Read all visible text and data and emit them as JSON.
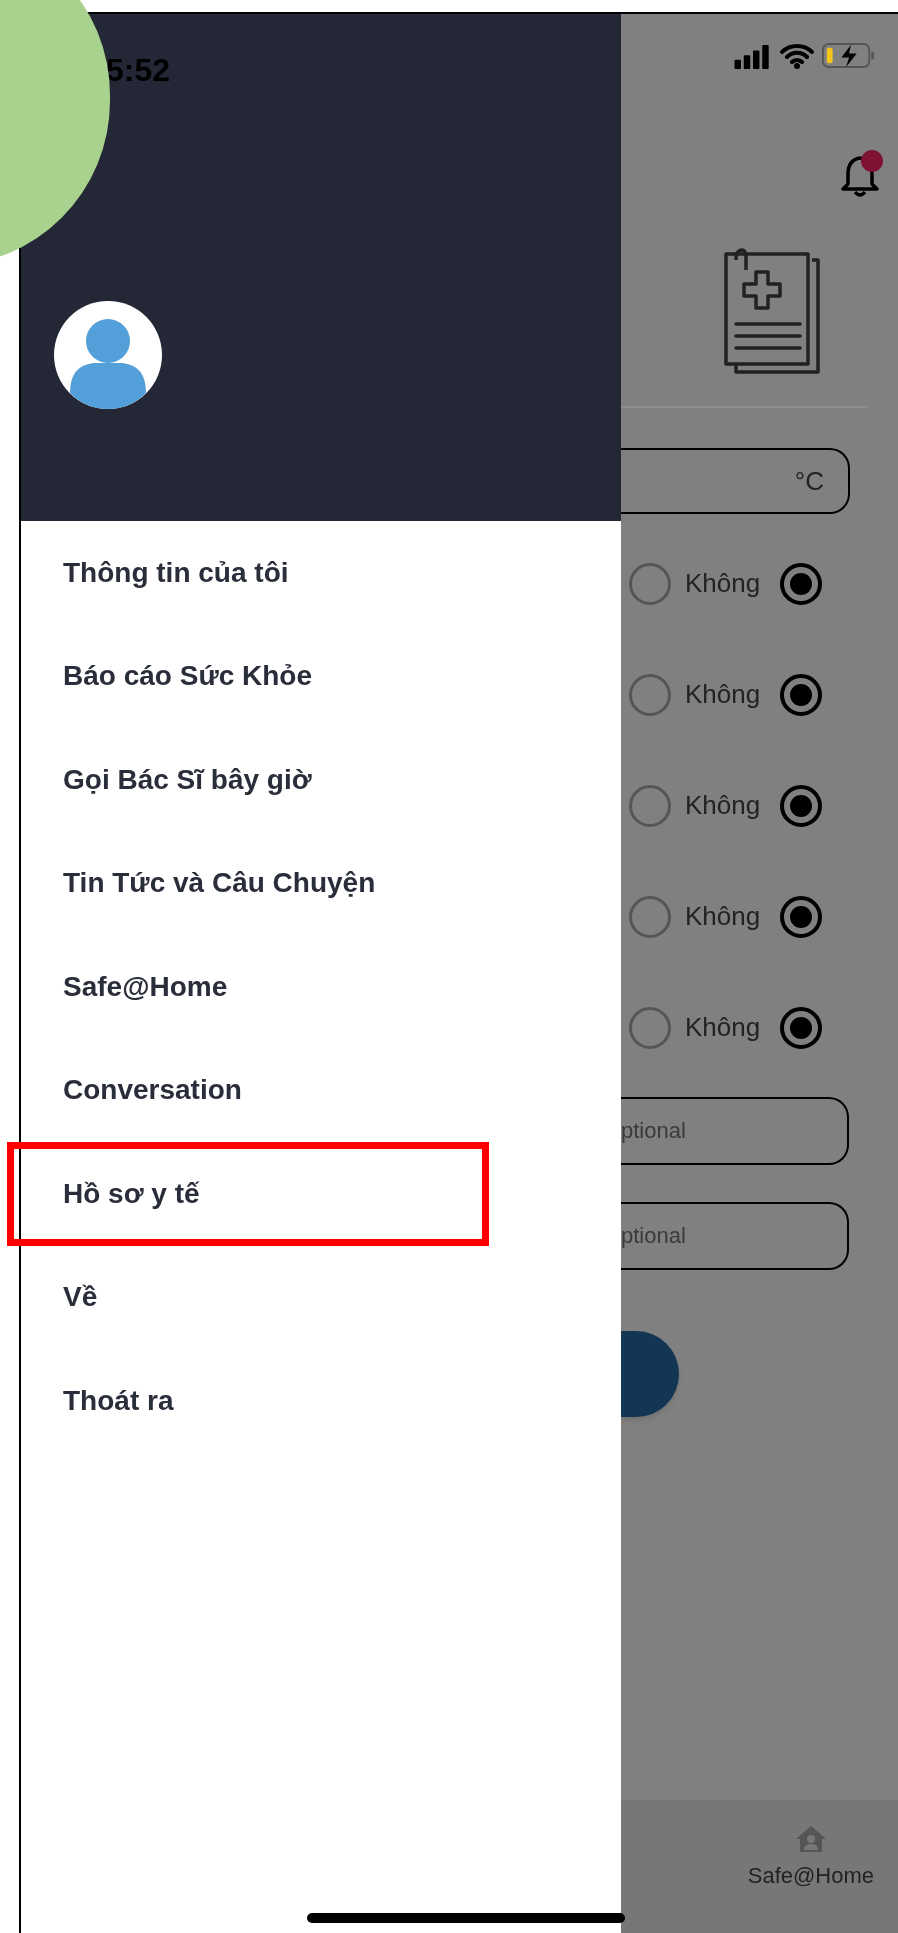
{
  "status_bar": {
    "time": "5:52"
  },
  "drawer": {
    "items": [
      {
        "label": "Thông tin của tôi",
        "highlighted": false
      },
      {
        "label": "Báo cáo Sức Khỏe",
        "highlighted": false
      },
      {
        "label": "Gọi Bác Sĩ bây giờ",
        "highlighted": false
      },
      {
        "label": "Tin Tức và Câu Chuyện",
        "highlighted": false
      },
      {
        "label": "Safe@Home",
        "highlighted": false
      },
      {
        "label": "Conversation",
        "highlighted": false
      },
      {
        "label": "Hồ sơ y tế",
        "highlighted": true
      },
      {
        "label": "Về",
        "highlighted": false
      },
      {
        "label": "Thoát ra",
        "highlighted": false
      }
    ]
  },
  "background_screen": {
    "has_notification": true,
    "temperature_field": {
      "unit": "°C"
    },
    "radio_rows": [
      {
        "options": [
          {
            "selected": false
          },
          {
            "label": "Không",
            "selected": true
          }
        ]
      },
      {
        "options": [
          {
            "selected": false
          },
          {
            "label": "Không",
            "selected": true
          }
        ]
      },
      {
        "options": [
          {
            "selected": false
          },
          {
            "label": "Không",
            "selected": true
          }
        ]
      },
      {
        "options": [
          {
            "selected": false
          },
          {
            "label": "Không",
            "selected": true
          }
        ]
      },
      {
        "options": [
          {
            "selected": false
          },
          {
            "label": "Không",
            "selected": true
          }
        ]
      }
    ],
    "optional_fields": [
      {
        "placeholder": "ptional"
      },
      {
        "placeholder": "ptional"
      }
    ],
    "tab_bar": [
      {
        "label": "Safe@Home"
      }
    ]
  }
}
